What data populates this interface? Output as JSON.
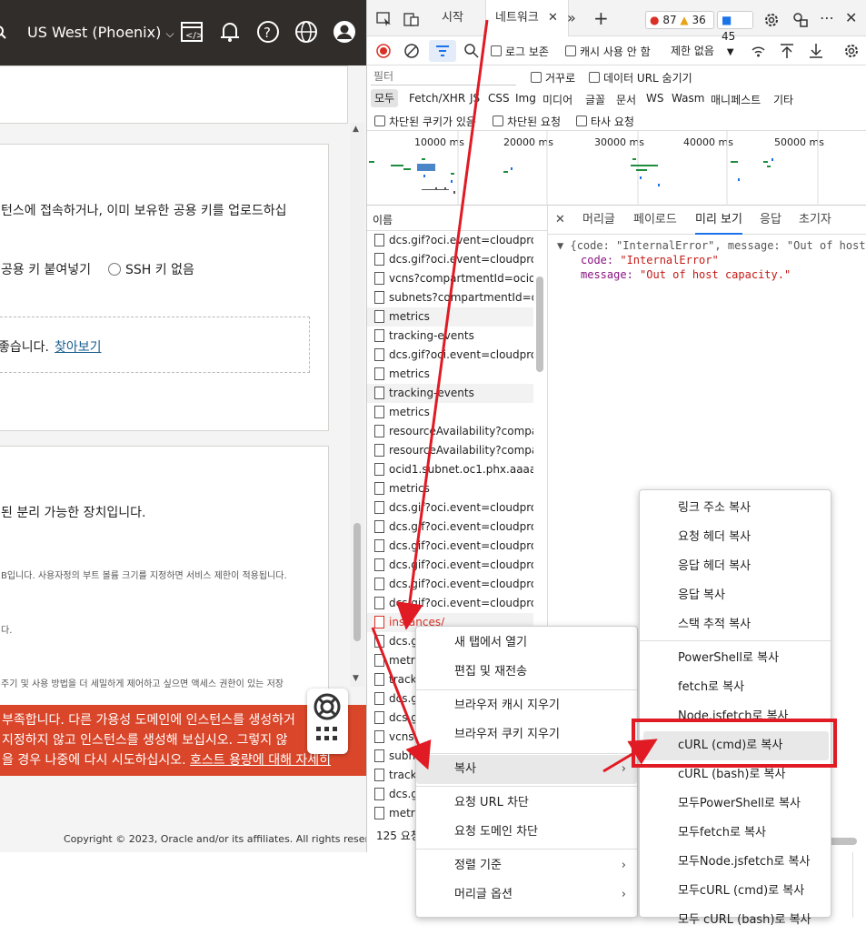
{
  "page": {
    "region": "US West (Phoenix)",
    "texts": {
      "ssh_intro": "턴스에 접속하거나, 이미 보유한 공용 키를 업로드하십",
      "paste_key": "공용 키 붙여넣기",
      "no_ssh": "SSH 키 없음",
      "hint_prefix": "좋습니다.",
      "hint_link": "찾아보기",
      "boot_desc": "된 분리 가능한 장치입니다.",
      "boot_size": "B입니다. 사용자정의 부트 볼륨 크기를 지정하면 서비스 제한이 적용됩니다.",
      "boot_small": "다.",
      "boot_more": "주기 및 사용 방법을 더 세밀하게 제어하고 싶으면 액세스 권한이 있는 저장"
    },
    "banner": {
      "line1": "부족합니다. 다른 가용성 도메인에 인스턴스를 생성하거",
      "line2": "지정하지 않고 인스턴스를 생성해 보십시오. 그렇지 않",
      "line3_prefix": "을 경우 나중에 다시 시도하십시오.",
      "line3_link": "호스트 용량에 대해 자세히"
    },
    "footer": "Copyright © 2023, Oracle and/or its affiliates. All rights reserved."
  },
  "devtools": {
    "tabs": [
      "시작",
      "네트워크"
    ],
    "errors": "87",
    "warnings": "36",
    "info": "45",
    "toolbar": {
      "preserve_log": "로그 보존",
      "disable_cache": "캐시 사용 안 함",
      "throttle": "제한 없음"
    },
    "filter_placeholder": "필터",
    "invert": "거꾸로",
    "hide_data_urls": "데이터 URL 숨기기",
    "types": [
      "모두",
      "Fetch/XHR",
      "JS",
      "CSS",
      "Img",
      "미디어",
      "글꼴",
      "문서",
      "WS",
      "Wasm",
      "매니페스트",
      "기타"
    ],
    "blocked_cookies": "차단된 쿠키가 있음",
    "blocked_requests": "차단된 요청",
    "third_party": "타사 요청",
    "timeline_ticks": [
      "10000 ms",
      "20000 ms",
      "30000 ms",
      "40000 ms",
      "50000 ms"
    ],
    "list_header": "이름",
    "requests": [
      "dcs.gif?oci.event=cloudprodu",
      "dcs.gif?oci.event=cloudprodu",
      "vcns?compartmentId=ocid1.te",
      "subnets?compartmentId=ocid",
      "metrics",
      "tracking-events",
      "dcs.gif?oci.event=cloudprodu",
      "metrics",
      "tracking-events",
      "metrics",
      "resourceAvailability?compart..",
      "resourceAvailability?compart..",
      "ocid1.subnet.oc1.phx.aaaaaaa",
      "metrics",
      "dcs.gif?oci.event=cloudprodu",
      "dcs.gif?oci.event=cloudprodu",
      "dcs.gif?oci.event=cloudprodu",
      "dcs.gif?oci.event=cloudprodu",
      "dcs.gif?oci.event=cloudprodu",
      "dcs.gif?oci.event=cloudprodu",
      "instances/",
      "dcs.gif",
      "metric",
      "trackin",
      "dcs.gi",
      "dcs.gi",
      "vcns?c",
      "subne",
      "trackin",
      "dcs.gi",
      "metric"
    ],
    "status": "125 요청",
    "detail_tabs": [
      "머리글",
      "페이로드",
      "미리 보기",
      "응답",
      "초기자"
    ],
    "preview": {
      "summary": "{code: \"InternalError\", message: \"Out of host capa",
      "code_key": "code:",
      "code_val": "\"InternalError\"",
      "msg_key": "message:",
      "msg_val": "\"Out of host capacity.\""
    }
  },
  "context_menu": {
    "items": [
      "새 탭에서 열기",
      "편집 및 재전송",
      "브라우저 캐시 지우기",
      "브라우저 쿠키 지우기",
      "복사",
      "요청 URL 차단",
      "요청 도메인 차단",
      "정렬 기준",
      "머리글 옵션"
    ]
  },
  "copy_submenu": {
    "items": [
      "링크 주소 복사",
      "요청 헤더 복사",
      "응답 헤더 복사",
      "응답 복사",
      "스택 추적 복사",
      "PowerShell로 복사",
      "fetch로 복사",
      "Node.jsfetch로 복사",
      "cURL (cmd)로 복사",
      "cURL (bash)로 복사",
      "모두PowerShell로 복사",
      "모두fetch로 복사",
      "모두Node.jsfetch로 복사",
      "모두cURL (cmd)로 복사",
      "모두 cURL (bash)로 복사"
    ]
  }
}
